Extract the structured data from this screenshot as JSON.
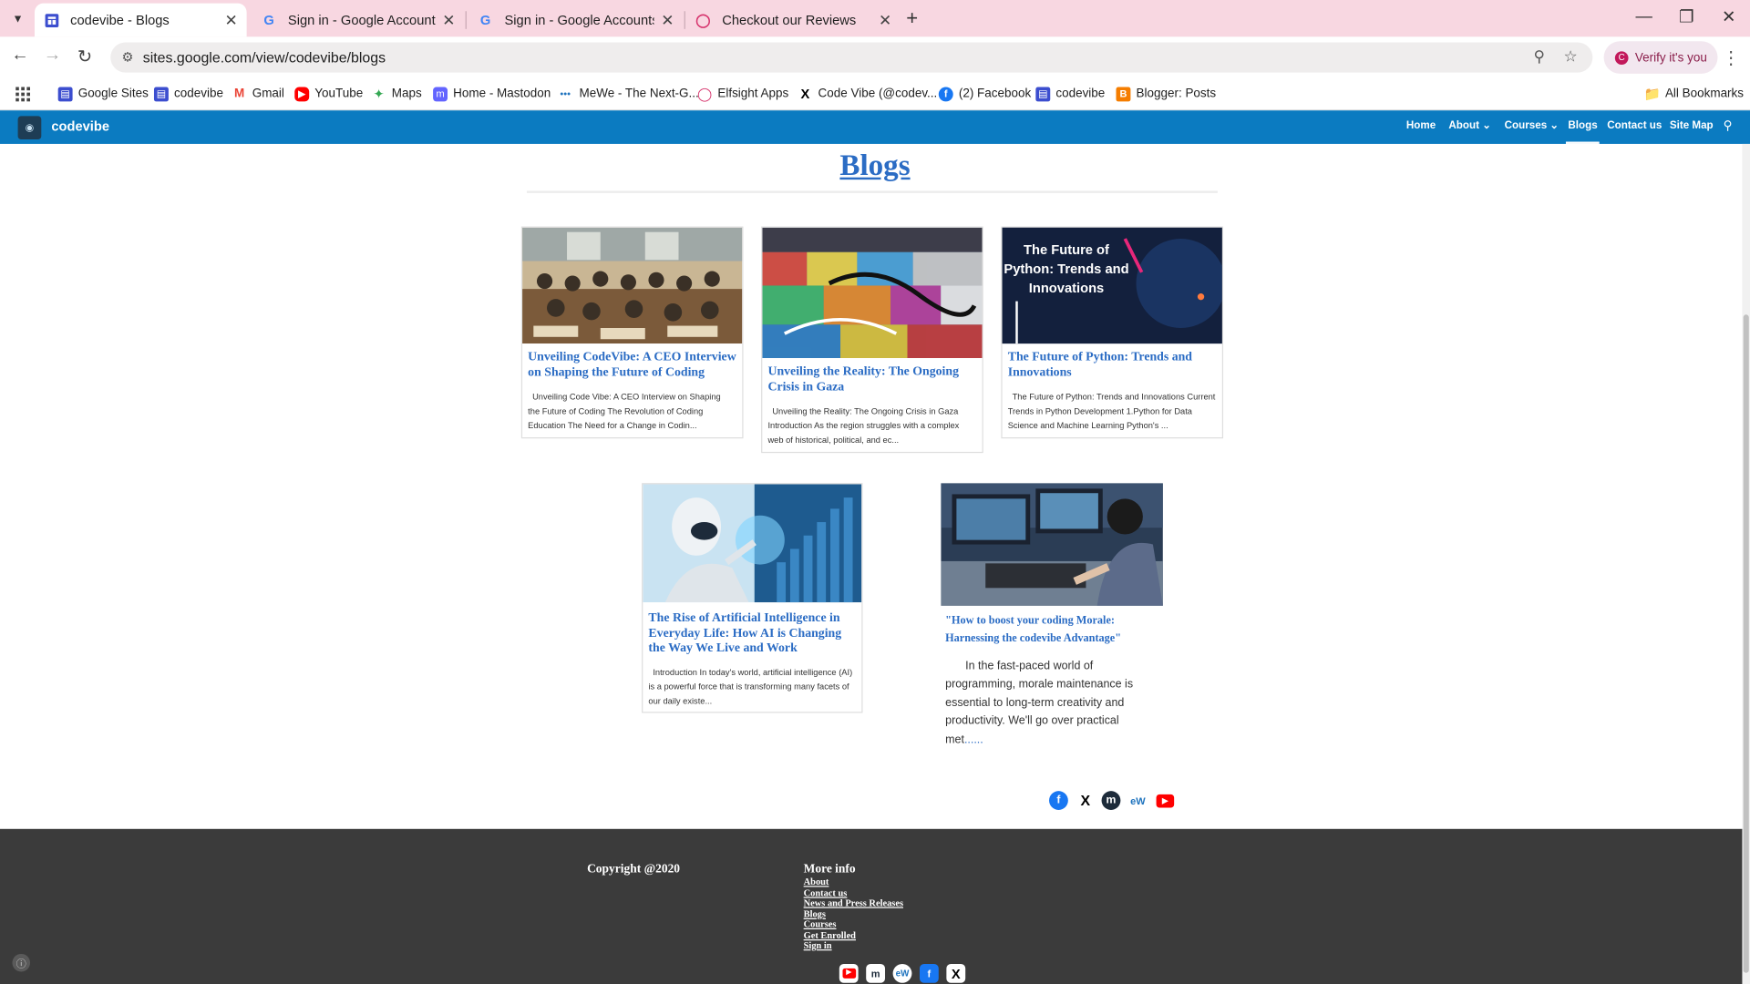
{
  "browser": {
    "tabs": [
      {
        "title": "codevibe - Blogs",
        "icon": "google-sites-icon",
        "active": true
      },
      {
        "title": "Sign in - Google Accounts",
        "icon": "google-g-icon",
        "active": false
      },
      {
        "title": "Sign in - Google Accounts",
        "icon": "google-g-icon",
        "active": false
      },
      {
        "title": "Checkout our Reviews",
        "icon": "elfsight-icon",
        "active": false
      }
    ],
    "url": "sites.google.com/view/codevibe/blogs",
    "profile_label": "Verify it's you",
    "bookmarks": [
      {
        "label": "Google Sites",
        "icon": "google-sites-icon"
      },
      {
        "label": "codevibe",
        "icon": "google-sites-icon"
      },
      {
        "label": "Gmail",
        "icon": "gmail-icon"
      },
      {
        "label": "YouTube",
        "icon": "youtube-icon"
      },
      {
        "label": "Maps",
        "icon": "maps-icon"
      },
      {
        "label": "Home - Mastodon",
        "icon": "mastodon-icon"
      },
      {
        "label": "MeWe - The Next-G...",
        "icon": "mewe-icon"
      },
      {
        "label": "Elfsight Apps",
        "icon": "elfsight-icon"
      },
      {
        "label": "Code Vibe (@codev...",
        "icon": "x-icon"
      },
      {
        "label": "(2) Facebook",
        "icon": "facebook-icon"
      },
      {
        "label": "codevibe",
        "icon": "google-sites-icon"
      },
      {
        "label": "Blogger: Posts",
        "icon": "blogger-icon"
      }
    ],
    "all_bookmarks": "All Bookmarks"
  },
  "site": {
    "name": "codevibe",
    "nav": [
      {
        "label": "Home",
        "dropdown": false,
        "active": false
      },
      {
        "label": "About",
        "dropdown": true,
        "active": false
      },
      {
        "label": "Courses",
        "dropdown": true,
        "active": false
      },
      {
        "label": "Blogs",
        "dropdown": false,
        "active": true
      },
      {
        "label": "Contact us",
        "dropdown": false,
        "active": false
      },
      {
        "label": "Site Map",
        "dropdown": false,
        "active": false
      }
    ]
  },
  "page": {
    "title": "Blogs",
    "cards": [
      {
        "title": "Unveiling CodeVibe: A CEO Interview on Shaping the Future of Coding",
        "excerpt": "Unveiling Code Vibe: A CEO Interview on Shaping the Future of Coding  The Revolution of Coding Education  The Need for a Change in Codin..."
      },
      {
        "title": "Unveiling the Reality: The Ongoing Crisis in Gaza",
        "excerpt": "Unveiling the Reality: The Ongoing Crisis in Gaza Introduction As the region struggles with a complex web of historical, political, and ec..."
      },
      {
        "title": "The Future of Python: Trends and Innovations",
        "excerpt": "The Future of Python: Trends and Innovations Current Trends in Python Development 1.Python for Data Science and Machine Learning Python's ...",
        "image_text": "The Future of Python: Trends and Innovations"
      },
      {
        "title": "The Rise of Artificial Intelligence in Everyday Life: How AI is Changing the Way We Live and Work",
        "excerpt": "Introduction In today's world, artificial intelligence (AI) is a powerful force that is transforming many facets of our daily existe..."
      }
    ],
    "featured": {
      "title": "\"How to boost your coding Morale: Harnessing the codevibe Advantage\"",
      "text": "In the fast-paced world of programming, morale maintenance is essential to long-term creativity and productivity. We'll go over practical met",
      "more": "......"
    },
    "social_icons": [
      "facebook-icon",
      "x-icon",
      "mastodon-icon",
      "mewe-icon",
      "youtube-icon"
    ]
  },
  "footer": {
    "copyright": "Copyright @2020",
    "more_info": "More info",
    "links": [
      "About ",
      "Contact us",
      "News and Press Releases ",
      "Blogs",
      "Courses",
      "Get Enrolled ",
      "Sign in"
    ],
    "social_icons": [
      "youtube-icon",
      "mastodon-icon",
      "mewe-icon",
      "facebook-icon",
      "x-icon"
    ]
  },
  "colors": {
    "tab_strip": "#f8d7e1",
    "site_nav": "#0b7bc1",
    "link_blue": "#2b6cc4",
    "footer_bg": "#3b3b3b"
  }
}
